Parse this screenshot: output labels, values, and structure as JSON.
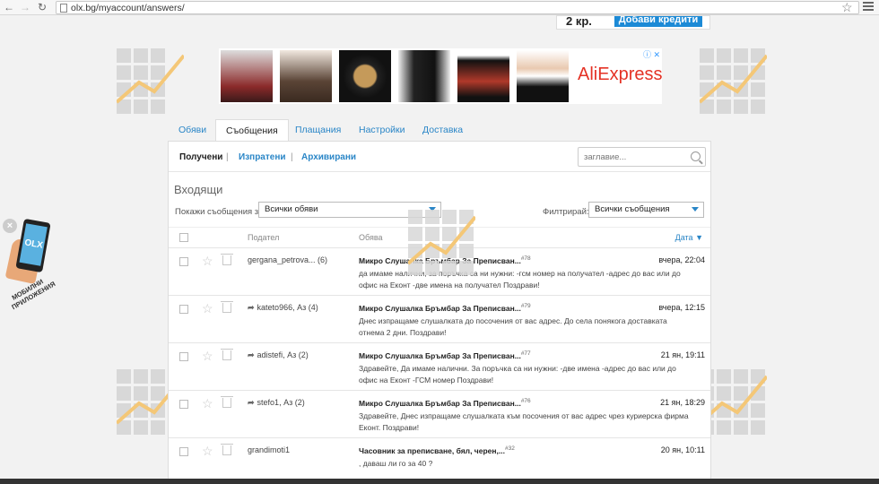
{
  "browser": {
    "url": "olx.bg/myaccount/answers/",
    "back_glyph": "←",
    "forward_glyph": "→",
    "reload_glyph": "↻",
    "bookmark_glyph": "☆"
  },
  "top_banner": {
    "text": "2 кр.",
    "button": "Добави кредити"
  },
  "ad": {
    "brand": "AliExpress",
    "close_label": "ⓘ ✕",
    "brand_color": "#e43225"
  },
  "tabs": [
    {
      "label": "Обяви"
    },
    {
      "label": "Съобщения"
    },
    {
      "label": "Плащания"
    },
    {
      "label": "Настройки"
    },
    {
      "label": "Доставка"
    }
  ],
  "subtabs": {
    "received": "Получени",
    "sent": "Изпратени",
    "archived": "Архивирани",
    "separator": "|"
  },
  "search": {
    "placeholder": "заглавие..."
  },
  "inbox": {
    "title": "Входящи",
    "show_label": "Покажи съобщения за:",
    "show_value": "Всички обяви",
    "filter_label": "Филтрирай:",
    "filter_value": "Всички съобщения"
  },
  "table": {
    "col_sender": "Подател",
    "col_ad": "Обява",
    "col_date": "Дата",
    "sort_glyph": "▼"
  },
  "rows": [
    {
      "sender": "gergana_petrova... (6)",
      "replied": false,
      "subject": "Микро Слушалка Бръмбар За Преписван...",
      "num": "#78",
      "preview": "да имаме налични, за поръчка са ни нужни: -гсм номер на получател -адрес до вас или до офис на Еконт -две имена на получател Поздрави!",
      "date": "вчера, 22:04"
    },
    {
      "sender": "kateto966, Аз (4)",
      "replied": true,
      "subject": "Микро Слушалка Бръмбар За Преписван...",
      "num": "#79",
      "preview": "Днес изпращаме слушалката до посочения от вас адрес. До села понякога доставката отнема 2 дни. Поздрави!",
      "date": "вчера, 12:15"
    },
    {
      "sender": "adistefi, Аз (2)",
      "replied": true,
      "subject": "Микро Слушалка Бръмбар За Преписван...",
      "num": "#77",
      "preview": "Здравейте, Да имаме налични. За поръчка са ни нужни: -две имена -адрес до вас или до офис на Еконт -ГСМ номер Поздрави!",
      "date": "21 ян, 19:11"
    },
    {
      "sender": "stefo1, Аз (2)",
      "replied": true,
      "subject": "Микро Слушалка Бръмбар За Преписван...",
      "num": "#76",
      "preview": "Здравейте, Днес изпращаме слушалката към посочения от вас адрес чрез куриерска фирма Еконт. Поздрави!",
      "date": "21 ян, 18:29"
    },
    {
      "sender": "grandimoti1",
      "replied": false,
      "subject": "Часовник за преписване, бял, черен,...",
      "num": "#32",
      "preview": ", даваш ли го за 40 ?",
      "date": "20 ян, 10:11"
    }
  ],
  "promo": {
    "close": "×",
    "logo": "OLX",
    "text": "МОБИЛНИ ПРИЛОЖЕНИЯ"
  },
  "reply_glyph": "➦",
  "star_glyph": "☆"
}
